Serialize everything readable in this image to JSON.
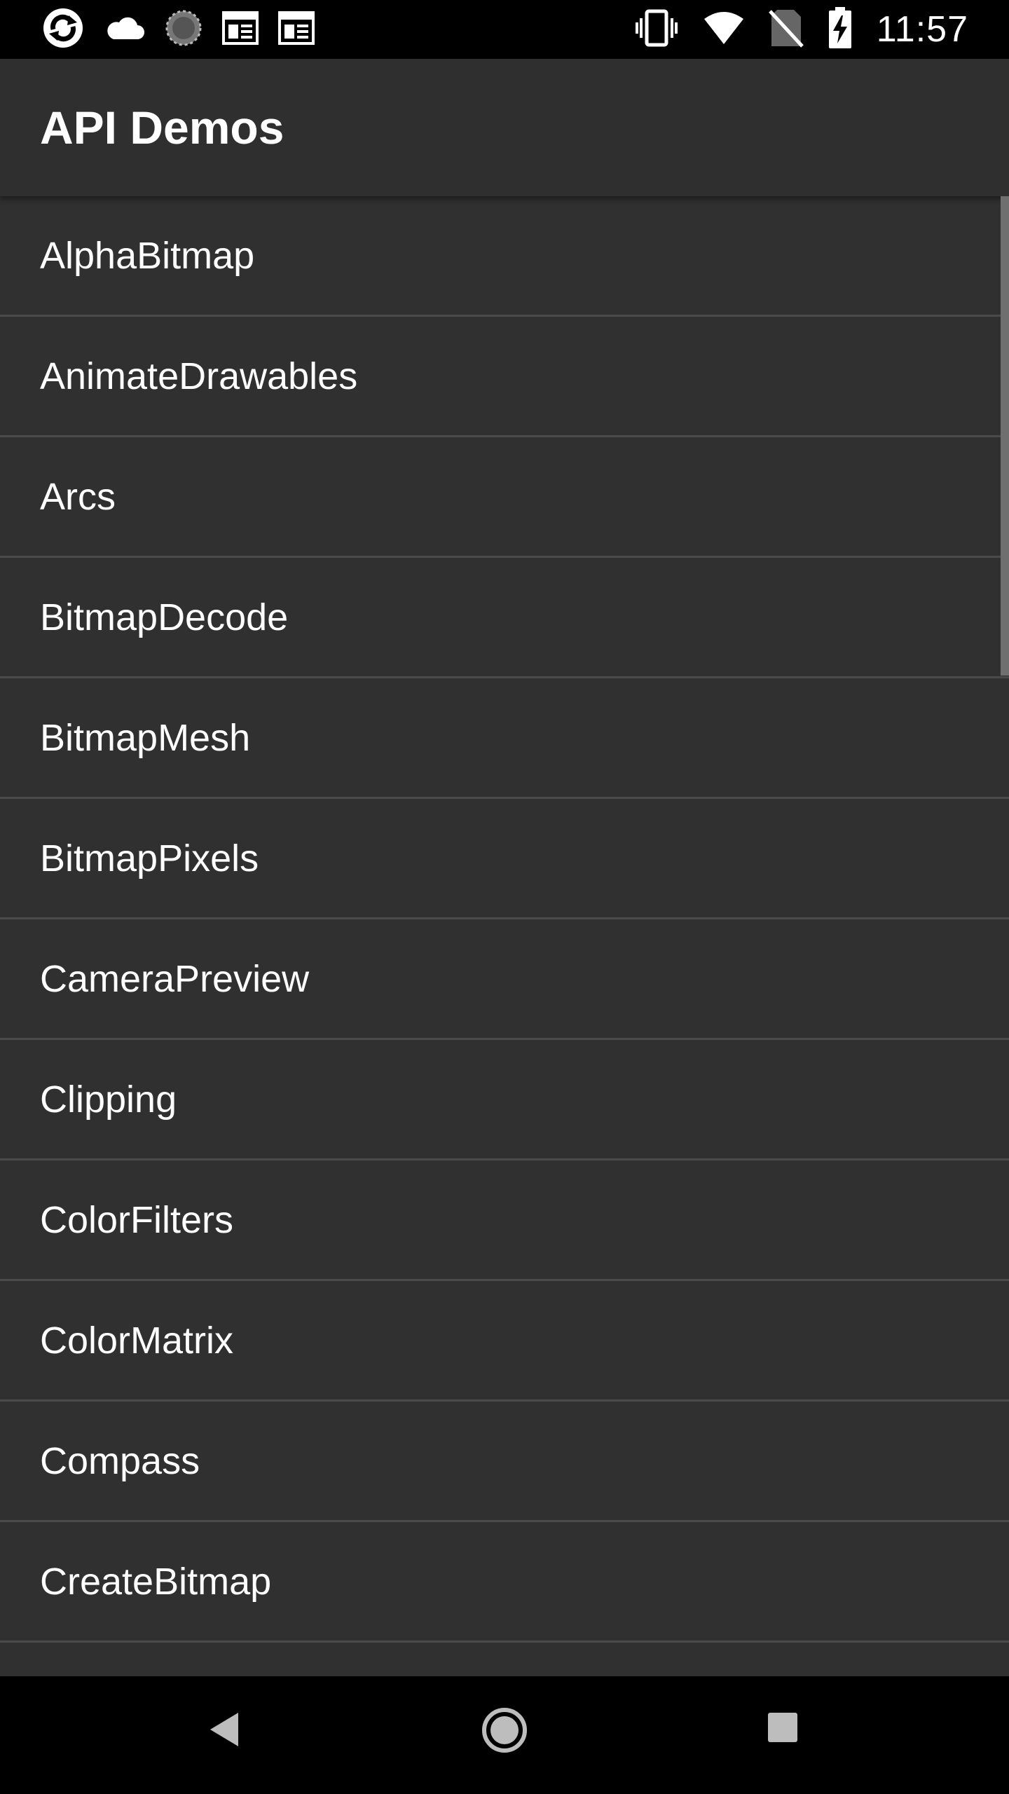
{
  "status_bar": {
    "time": "11:57",
    "left_icons": [
      "sync-app-icon",
      "cloud-icon",
      "loading-spinner-icon",
      "calendar-notification-icon",
      "calendar-notification-icon"
    ],
    "right_icons": [
      "vibrate-icon",
      "wifi-icon",
      "no-sim-icon",
      "battery-charging-icon"
    ]
  },
  "app_bar": {
    "title": "API Demos"
  },
  "list": {
    "items": [
      {
        "label": "AlphaBitmap"
      },
      {
        "label": "AnimateDrawables"
      },
      {
        "label": "Arcs"
      },
      {
        "label": "BitmapDecode"
      },
      {
        "label": "BitmapMesh"
      },
      {
        "label": "BitmapPixels"
      },
      {
        "label": "CameraPreview"
      },
      {
        "label": "Clipping"
      },
      {
        "label": "ColorFilters"
      },
      {
        "label": "ColorMatrix"
      },
      {
        "label": "Compass"
      },
      {
        "label": "CreateBitmap"
      },
      {
        "label": ""
      }
    ]
  },
  "nav_bar": {
    "buttons": [
      "back-icon",
      "home-icon",
      "recents-icon"
    ]
  },
  "colors": {
    "background": "#303030",
    "app_bar": "#2f2f2f",
    "divider": "#4a4a4a",
    "text": "#ffffff"
  }
}
